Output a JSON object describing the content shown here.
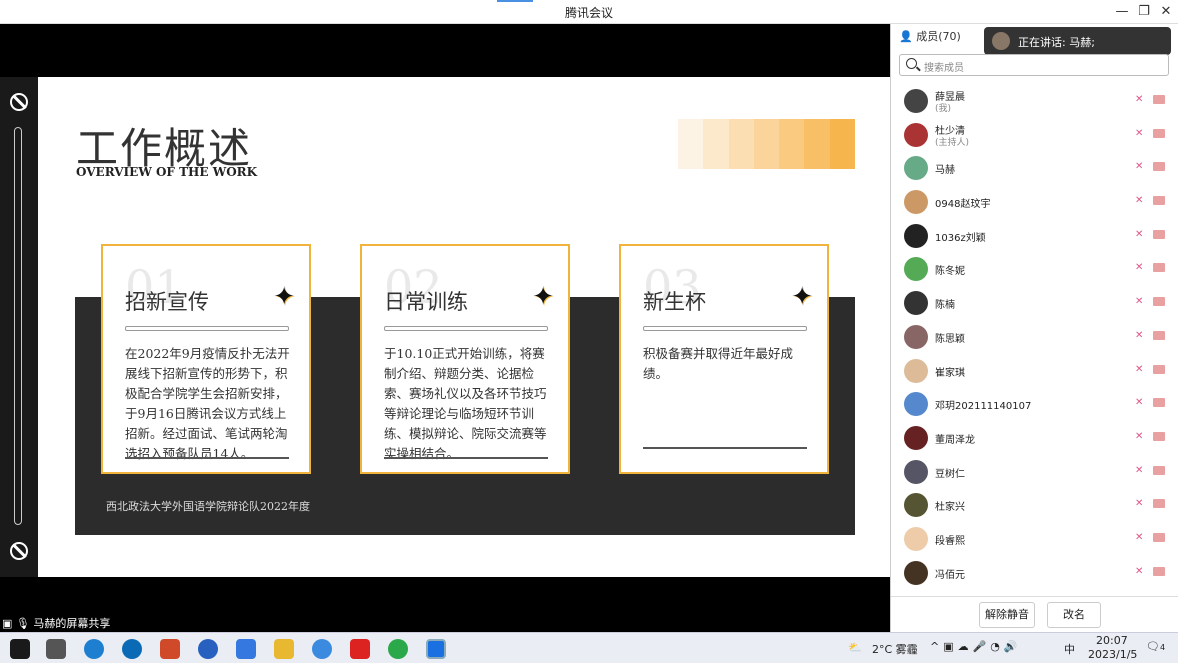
{
  "window": {
    "title": "腾讯会议",
    "minimize": "—",
    "restore": "❐",
    "close": "✕"
  },
  "slide": {
    "heading": "工作概述",
    "subheading": "OVERVIEW OF THE WORK",
    "footer": "西北政法大学外国语学院辩论队2022年度",
    "cards": [
      {
        "num": "01",
        "title": "招新宣传",
        "body": "在2022年9月疫情反扑无法开展线下招新宣传的形势下，积极配合学院学生会招新安排，于9月16日腾讯会议方式线上招新。经过面试、笔试两轮淘选招入预备队员14人。"
      },
      {
        "num": "02",
        "title": "日常训练",
        "body": "于10.10正式开始训练，将赛制介绍、辩题分类、论据检索、赛场礼仪以及各环节技巧等辩论理论与临场短环节训练、模拟辩论、院际交流赛等实操相结合。"
      },
      {
        "num": "03",
        "title": "新生杯",
        "body": "积极备赛并取得近年最好成绩。"
      }
    ],
    "gradient_colors": [
      "#fdf3e4",
      "#fce9cc",
      "#fbdfb3",
      "#fad49a",
      "#f9ca80",
      "#f8bf66",
      "#f7b54d"
    ],
    "accent_color": "#f0b43c"
  },
  "share_label": "马赫的屏幕共享",
  "panel": {
    "member_count": "成员(70)",
    "speaking": "正在讲话: 马赫;",
    "search_placeholder": "搜索成员",
    "members": [
      {
        "name": "薛昱晨",
        "sub": "(我)",
        "color": "#444"
      },
      {
        "name": "杜少清",
        "sub": "(主持人)",
        "color": "#a33"
      },
      {
        "name": "马赫",
        "sub": "",
        "color": "#6a8"
      },
      {
        "name": "0948赵玟宇",
        "sub": "",
        "color": "#c96"
      },
      {
        "name": "1036z刘颖",
        "sub": "",
        "color": "#222"
      },
      {
        "name": "陈冬妮",
        "sub": "",
        "color": "#5a5"
      },
      {
        "name": "陈楠",
        "sub": "",
        "color": "#333"
      },
      {
        "name": "陈思颖",
        "sub": "",
        "color": "#866"
      },
      {
        "name": "崔家琪",
        "sub": "",
        "color": "#db9"
      },
      {
        "name": "邓玥202111140107",
        "sub": "",
        "color": "#58c"
      },
      {
        "name": "董周泽龙",
        "sub": "",
        "color": "#622"
      },
      {
        "name": "豆树仁",
        "sub": "",
        "color": "#556"
      },
      {
        "name": "杜家兴",
        "sub": "",
        "color": "#553"
      },
      {
        "name": "段睿熙",
        "sub": "",
        "color": "#eca"
      },
      {
        "name": "冯佰元",
        "sub": "",
        "color": "#432"
      }
    ],
    "unmute_button": "解除静音",
    "rename_button": "改名"
  },
  "taskbar": {
    "weather": "2°C 雾霾",
    "ime": "中",
    "time": "20:07",
    "date": "2023/1/5",
    "notif_count": "4"
  }
}
